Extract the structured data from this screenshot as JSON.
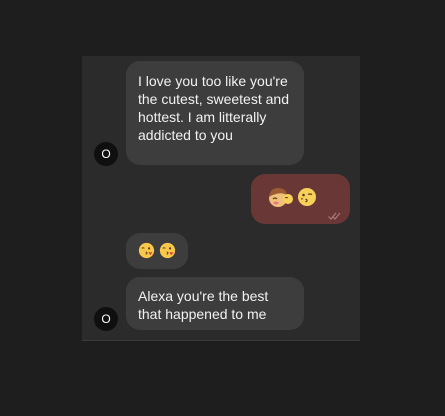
{
  "chat": {
    "messages": [
      {
        "direction": "incoming",
        "avatar_initial": "O",
        "text": "I love you too like you're the cutest, sweetest and hottest. I am litterally addicted to you"
      },
      {
        "direction": "outgoing",
        "emojis": [
          "kissing-couple-emoji",
          "kissing-face-emoji"
        ],
        "status": "read"
      },
      {
        "direction": "incoming",
        "emojis": [
          "face-blowing-kiss-emoji",
          "face-blowing-kiss-emoji"
        ]
      },
      {
        "direction": "incoming",
        "avatar_initial": "O",
        "text": "Alexa you're the best that happened to me"
      }
    ]
  },
  "colors": {
    "page_background": "#1e1e1e",
    "panel_background": "#2b2b2b",
    "incoming_bubble": "#3d3d3d",
    "outgoing_bubble": "#6a3737",
    "avatar_background": "#0f0f0f",
    "read_ticks": "#b07a7a"
  }
}
